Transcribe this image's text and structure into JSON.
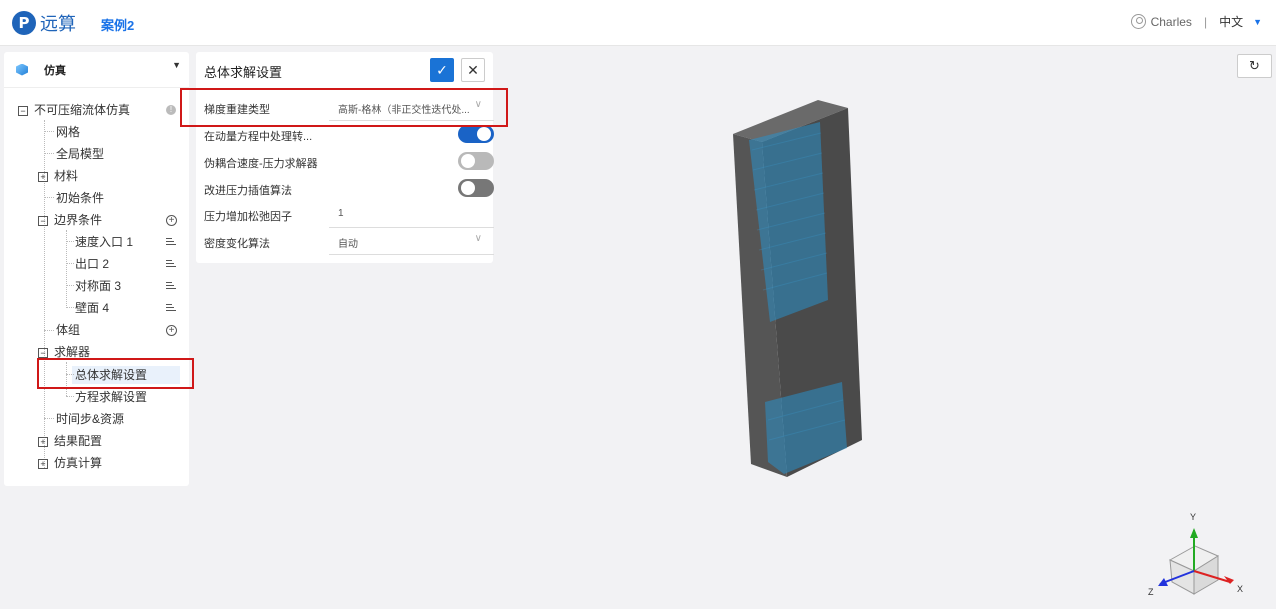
{
  "header": {
    "logo_mark": "P",
    "logo_text": "远算",
    "project": "案例2",
    "user": "Charles",
    "separator": "|",
    "language": "中文"
  },
  "left_panel": {
    "title": "仿真",
    "tree": {
      "root": "不可压缩流体仿真",
      "mesh": "网格",
      "global_model": "全局模型",
      "material": "材料",
      "initial": "初始条件",
      "boundary": "边界条件",
      "bc_items": [
        "速度入口 1",
        "出口 2",
        "对称面 3",
        "壁面 4"
      ],
      "volume_group": "体组",
      "solver": "求解器",
      "solver_items": [
        "总体求解设置",
        "方程求解设置"
      ],
      "timestep": "时间步&资源",
      "result_config": "结果配置",
      "simulate": "仿真计算"
    }
  },
  "settings": {
    "title": "总体求解设置",
    "rows": [
      {
        "label": "梯度重建类型",
        "value": "高斯-格林（非正交性迭代处..."
      },
      {
        "label": "在动量方程中处理转...",
        "toggle": true
      },
      {
        "label": "伪耦合速度-压力求解器",
        "toggle": false
      },
      {
        "label": "改进压力插值算法",
        "toggle": false
      },
      {
        "label": "压力增加松弛因子",
        "value": "1"
      },
      {
        "label": "密度变化算法",
        "value": "自动"
      }
    ]
  },
  "axes": {
    "x": "X",
    "y": "Y",
    "z": "Z"
  },
  "colors": {
    "accent": "#1a73d6",
    "highlight": "#d01818"
  }
}
